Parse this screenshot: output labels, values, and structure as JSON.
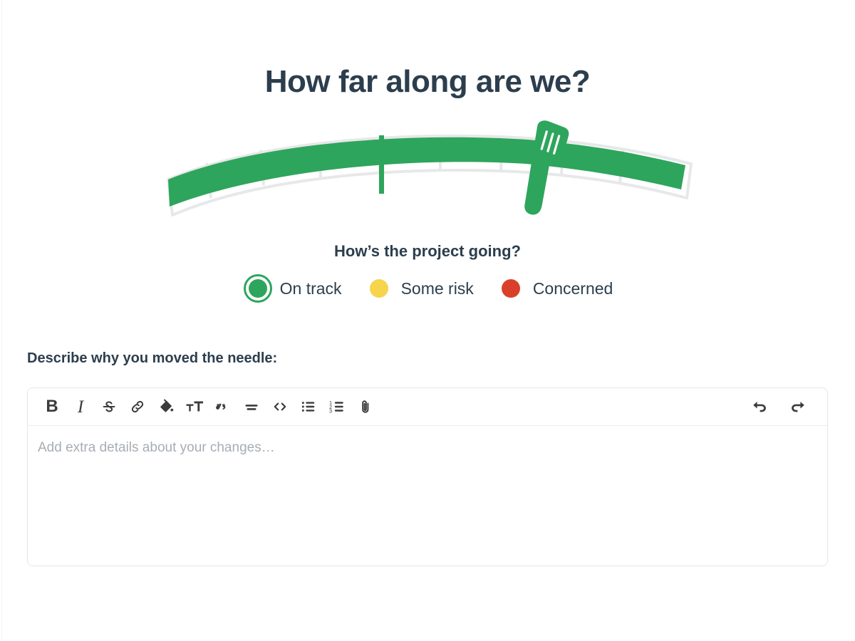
{
  "page": {
    "title": "How far along are we?",
    "text_color": "#2c3e4d",
    "background": "#ffffff"
  },
  "gauge": {
    "name": "progress-needle-gauge",
    "fill_color": "#2ea55c",
    "track_color": "#e7e8e9",
    "progress_percent": 75,
    "total_segments": 8,
    "filled_segments": 6,
    "milestone_marker_position_percent": 48,
    "handle": {
      "name": "gauge-needle-handle",
      "grip_lines": 3,
      "color": "#2ea55c"
    }
  },
  "status": {
    "question": "How’s the project going?",
    "selected": "On track",
    "options": [
      {
        "label": "On track",
        "color": "#2ea55c",
        "selected": true
      },
      {
        "label": "Some risk",
        "color": "#f6d44c",
        "selected": false
      },
      {
        "label": "Concerned",
        "color": "#d9402a",
        "selected": false
      }
    ]
  },
  "describe": {
    "label": "Describe why you moved the needle:",
    "placeholder": "Add extra details about your changes…",
    "value": ""
  },
  "toolbar": {
    "icon_color": "#3c3c3c",
    "left_tools": [
      {
        "name": "bold-icon",
        "label": "B",
        "kind": "text-bold"
      },
      {
        "name": "italic-icon",
        "label": "I",
        "kind": "text-italic"
      },
      {
        "name": "strikethrough-icon",
        "label": "S",
        "kind": "strikethrough"
      },
      {
        "name": "link-icon",
        "label": "Link",
        "kind": "link"
      },
      {
        "name": "highlight-icon",
        "label": "Highlight",
        "kind": "bucket"
      },
      {
        "name": "text-size-icon",
        "label": "Text size",
        "kind": "text-size"
      },
      {
        "name": "quote-icon",
        "label": "Quote",
        "kind": "quote"
      },
      {
        "name": "divider-icon",
        "label": "Divider",
        "kind": "divider"
      },
      {
        "name": "code-icon",
        "label": "Code",
        "kind": "code"
      },
      {
        "name": "bulleted-list-icon",
        "label": "Bulleted list",
        "kind": "bullet-list"
      },
      {
        "name": "numbered-list-icon",
        "label": "Numbered list",
        "kind": "number-list"
      },
      {
        "name": "attachment-icon",
        "label": "Attach file",
        "kind": "paperclip"
      }
    ],
    "right_tools": [
      {
        "name": "undo-icon",
        "label": "Undo",
        "kind": "undo"
      },
      {
        "name": "redo-icon",
        "label": "Redo",
        "kind": "redo"
      }
    ]
  }
}
